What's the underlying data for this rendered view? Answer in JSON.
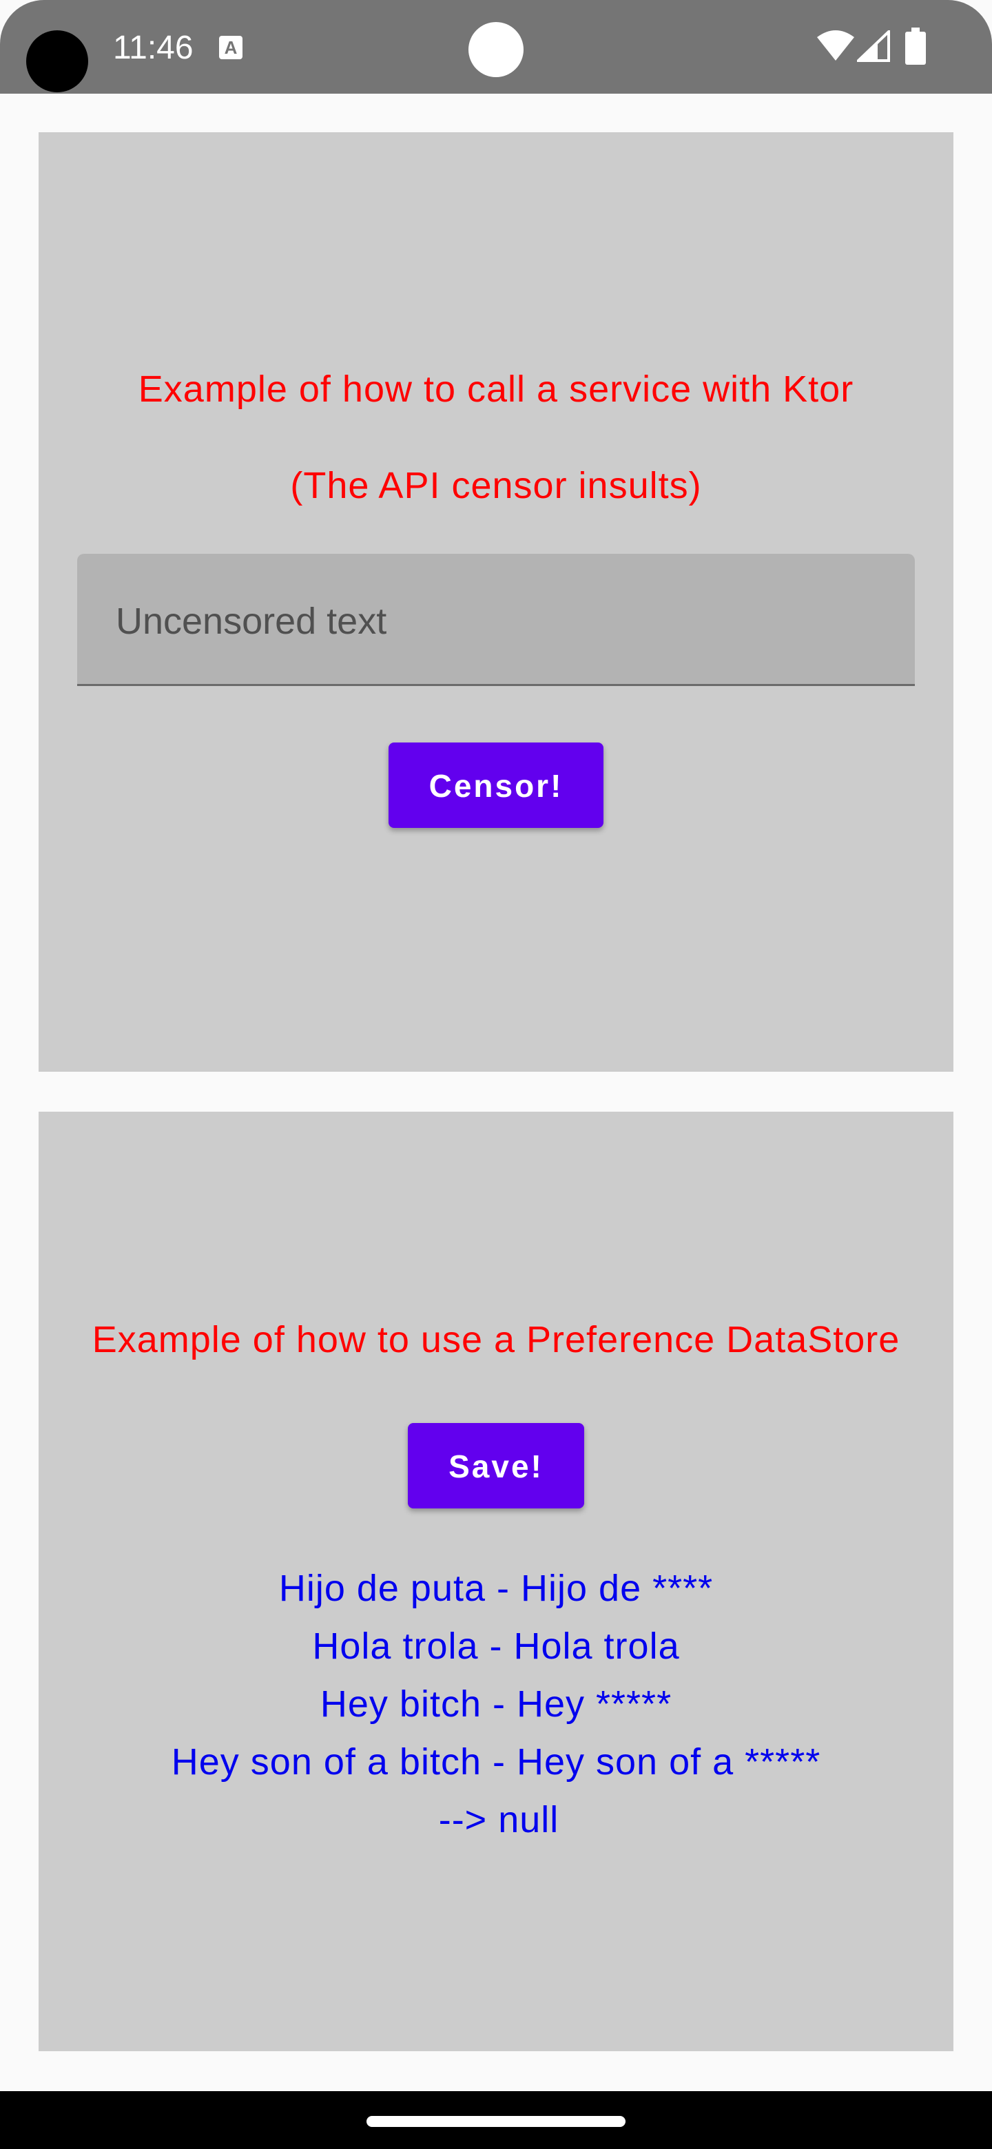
{
  "status_bar": {
    "time": "11:46",
    "notification_icon": "translate-icon",
    "notification_glyph": "A",
    "icons": [
      "wifi-icon",
      "cellular-signal-icon",
      "battery-icon"
    ]
  },
  "ktor_card": {
    "title": "Example of how to call a service with Ktor",
    "subtitle": "(The API censor insults)",
    "input_placeholder": "Uncensored text",
    "input_value": "",
    "button_label": "Censor!"
  },
  "datastore_card": {
    "title": "Example of how to use a Preference DataStore",
    "button_label": "Save!",
    "results": [
      "Hijo de puta - Hijo de ****",
      "Hola trola - Hola trola",
      "Hey bitch - Hey *****",
      "Hey son of a bitch - Hey son of a *****",
      "--> null"
    ]
  },
  "colors": {
    "status_bar": "#757575",
    "card_background": "#cccccc",
    "title_red": "#ff0000",
    "button_purple": "#6200ee",
    "result_blue": "#0000ee"
  }
}
